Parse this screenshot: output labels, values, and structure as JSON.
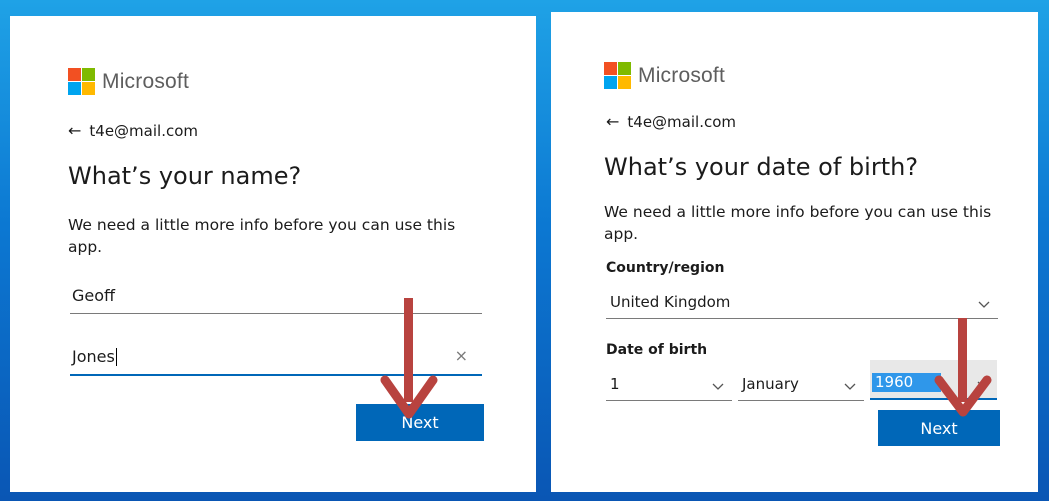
{
  "colors": {
    "accent": "#0067b8",
    "ms_red": "#f25022",
    "ms_green": "#7fba00",
    "ms_blue": "#00a4ef",
    "ms_yellow": "#ffb900",
    "annotation_arrow": "#b8433f"
  },
  "brand": {
    "name": "Microsoft"
  },
  "left": {
    "back_email": "t4e@mail.com",
    "title": "What’s your name?",
    "description": "We need a little more info before you can use this app.",
    "first_name_value": "Geoff",
    "last_name_value": "Jones",
    "clear_icon": "×",
    "next_label": "Next"
  },
  "right": {
    "back_email": "t4e@mail.com",
    "title": "What’s your date of birth?",
    "description": "We need a little more info before you can use this app.",
    "country_label": "Country/region",
    "country_value": "United Kingdom",
    "dob_label": "Date of birth",
    "day_value": "1",
    "month_value": "January",
    "year_value": "1960",
    "next_label": "Next"
  },
  "icons": {
    "back": "back-arrow-icon",
    "clear": "close-icon",
    "chevron": "chevron-down-icon",
    "annotation": "down-arrow-annotation-icon"
  }
}
